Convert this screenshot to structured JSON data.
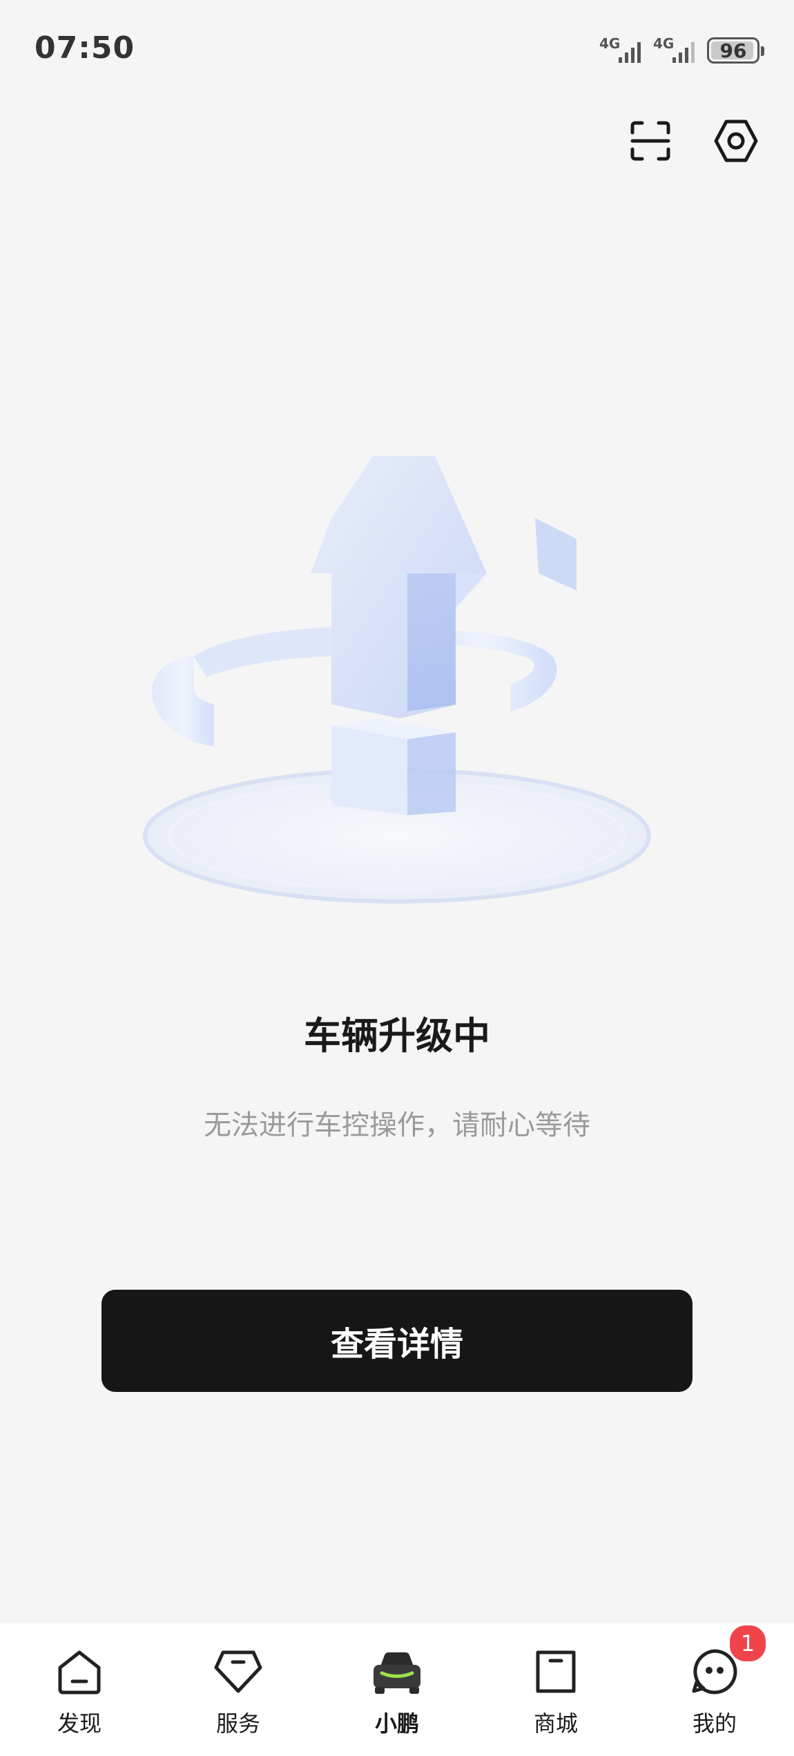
{
  "status_bar": {
    "time": "07:50",
    "signals": [
      {
        "network": "4G"
      },
      {
        "network": "4G"
      }
    ],
    "battery_level": "96"
  },
  "top_actions": [
    {
      "icon": "scan-icon"
    },
    {
      "icon": "settings-hex-icon"
    }
  ],
  "hero": {
    "icon": "upgrade-arrow-illustration"
  },
  "main": {
    "title": "车辆升级中",
    "subtitle": "无法进行车控操作，请耐心等待",
    "button_label": "查看详情"
  },
  "tab_bar": {
    "items": [
      {
        "label": "发现",
        "icon": "discover-icon",
        "active": false
      },
      {
        "label": "服务",
        "icon": "service-icon",
        "active": false
      },
      {
        "label": "小鹏",
        "icon": "car-icon",
        "active": true
      },
      {
        "label": "商城",
        "icon": "shop-icon",
        "active": false
      },
      {
        "label": "我的",
        "icon": "profile-icon",
        "active": false,
        "badge": "1"
      }
    ]
  },
  "colors": {
    "background": "#f5f5f5",
    "button": "#161616",
    "accent_green": "#9be34a",
    "badge_red": "#f0444b",
    "subtitle_gray": "#9a9a9a"
  }
}
